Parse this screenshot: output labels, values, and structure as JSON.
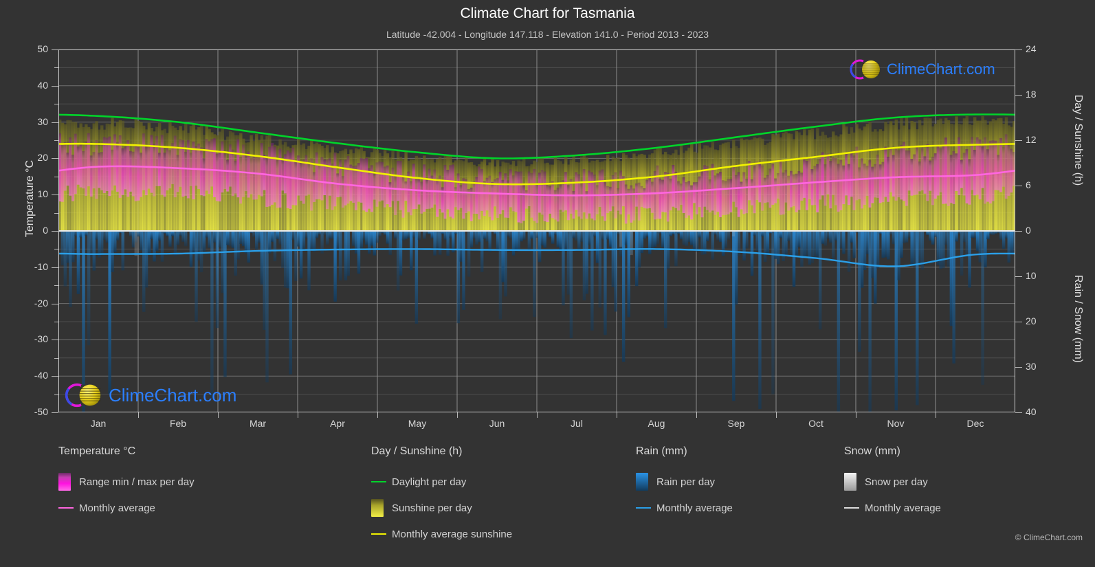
{
  "header": {
    "title": "Climate Chart for Tasmania",
    "subtitle": "Latitude -42.004 - Longitude 147.118 - Elevation 141.0 - Period 2013 - 2023"
  },
  "branding": {
    "logo_text": "ClimeChart.com",
    "copyright": "© ClimeChart.com"
  },
  "axes": {
    "left_title": "Temperature °C",
    "right_title_top": "Day / Sunshine (h)",
    "right_title_bottom": "Rain / Snow (mm)",
    "left_ticks": [
      "50",
      "40",
      "30",
      "20",
      "10",
      "0",
      "-10",
      "-20",
      "-30",
      "-40",
      "-50"
    ],
    "right_ticks_top": [
      "24",
      "18",
      "12",
      "6",
      "0"
    ],
    "right_ticks_bottom": [
      "10",
      "20",
      "30",
      "40"
    ],
    "x_ticks": [
      "Jan",
      "Feb",
      "Mar",
      "Apr",
      "May",
      "Jun",
      "Jul",
      "Aug",
      "Sep",
      "Oct",
      "Nov",
      "Dec"
    ]
  },
  "legend": {
    "columns": [
      {
        "heading": "Temperature °C",
        "items": [
          {
            "label": "Range min / max per day",
            "mark": "swatch",
            "color": "#ff00e0"
          },
          {
            "label": "Monthly average",
            "mark": "line",
            "color": "#ff66e0"
          }
        ]
      },
      {
        "heading": "Day / Sunshine (h)",
        "items": [
          {
            "label": "Daylight per day",
            "mark": "line",
            "color": "#00d42a"
          },
          {
            "label": "Sunshine per day",
            "mark": "swatch",
            "color": "#f2f23a"
          },
          {
            "label": "Monthly average sunshine",
            "mark": "line",
            "color": "#f2f200"
          }
        ]
      },
      {
        "heading": "Rain (mm)",
        "items": [
          {
            "label": "Rain per day",
            "mark": "swatch",
            "color": "#1f8fe8"
          },
          {
            "label": "Monthly average",
            "mark": "line",
            "color": "#2b9fe8"
          }
        ]
      },
      {
        "heading": "Snow (mm)",
        "items": [
          {
            "label": "Snow per day",
            "mark": "swatch",
            "color": "#e8e8e8"
          },
          {
            "label": "Monthly average",
            "mark": "line",
            "color": "#dddddd"
          }
        ]
      }
    ]
  },
  "chart_data": {
    "type": "area",
    "title": "Climate Chart for Tasmania",
    "subtitle": "Latitude -42.004 - Longitude 147.118 - Elevation 141.0 - Period 2013 - 2023",
    "xlabel": "",
    "ylabel": "Temperature °C",
    "ylim": [
      -50,
      50
    ],
    "y2lim_top": [
      0,
      24
    ],
    "y2lim_bottom": [
      0,
      40
    ],
    "grid": true,
    "legend_position": "below",
    "categories": [
      "Jan",
      "Feb",
      "Mar",
      "Apr",
      "May",
      "Jun",
      "Jul",
      "Aug",
      "Sep",
      "Oct",
      "Nov",
      "Dec"
    ],
    "series": [
      {
        "name": "Daylight per day",
        "units": "h",
        "color": "#00d42a",
        "values": [
          15.2,
          14.4,
          13.0,
          11.6,
          10.4,
          9.6,
          10.0,
          11.0,
          12.4,
          13.8,
          15.0,
          15.4
        ]
      },
      {
        "name": "Monthly average sunshine",
        "units": "h",
        "color": "#f2f200",
        "values": [
          11.5,
          11.0,
          9.9,
          8.4,
          7.0,
          6.2,
          6.4,
          7.2,
          8.6,
          9.8,
          11.0,
          11.4
        ]
      },
      {
        "name": "Temperature monthly average",
        "units": "°C",
        "color": "#ff66e0",
        "values": [
          17.7,
          17.3,
          15.8,
          13.0,
          11.2,
          10.3,
          9.8,
          10.4,
          11.8,
          13.4,
          14.8,
          15.4
        ]
      },
      {
        "name": "Temperature range max per day",
        "units": "°C",
        "color": "#ff00e0",
        "values": [
          24.0,
          23.6,
          21.8,
          18.4,
          15.8,
          14.4,
          13.8,
          14.8,
          16.6,
          18.8,
          21.4,
          23.0
        ]
      },
      {
        "name": "Temperature range min per day",
        "units": "°C",
        "color": "#ff00e0",
        "values": [
          10.5,
          10.4,
          9.2,
          7.2,
          5.8,
          4.6,
          4.2,
          4.8,
          6.0,
          7.4,
          8.8,
          9.6
        ]
      },
      {
        "name": "Rain monthly average",
        "units": "mm",
        "color": "#2b9fe8",
        "values": [
          5.1,
          5.0,
          4.4,
          4.1,
          4.0,
          4.2,
          4.2,
          4.0,
          4.6,
          6.0,
          7.8,
          5.2
        ]
      },
      {
        "name": "Snow monthly average",
        "units": "mm",
        "color": "#dddddd",
        "values": [
          0,
          0,
          0,
          0,
          0,
          0,
          0,
          0,
          0,
          0,
          0,
          0
        ]
      }
    ]
  }
}
